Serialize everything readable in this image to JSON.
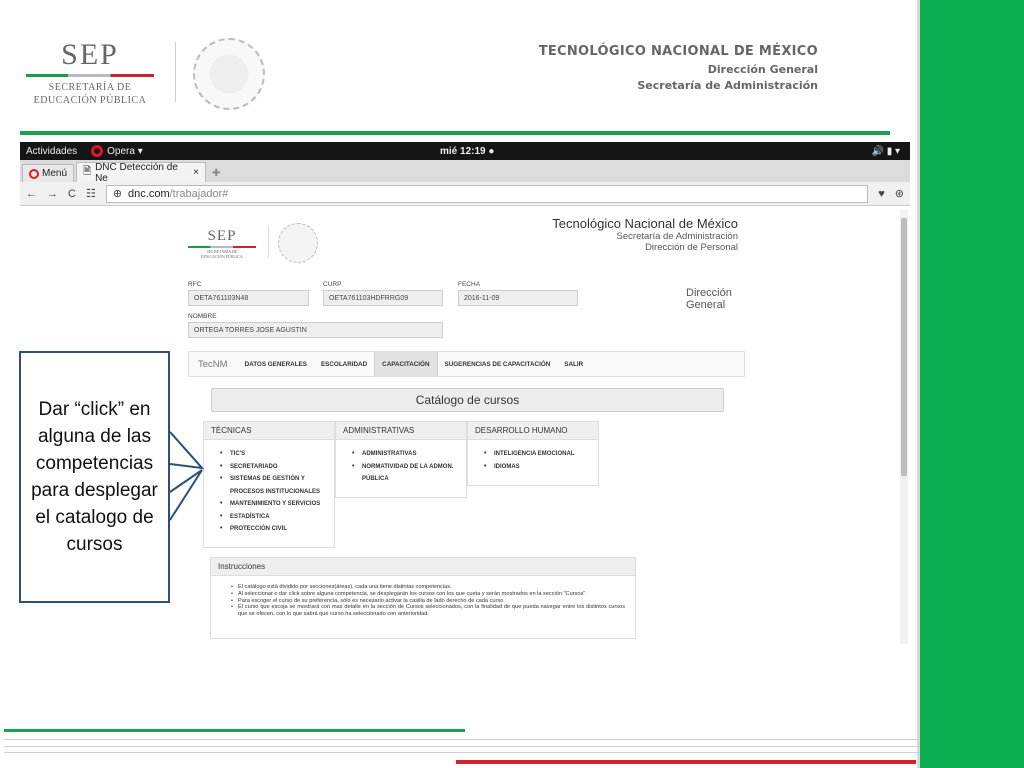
{
  "slide_header": {
    "sep_logo": {
      "sep": "SEP",
      "line1": "SECRETARÍA DE",
      "line2": "EDUCACIÓN PÚBLICA"
    },
    "title": "TECNOLÓGICO NACIONAL DE MÉXICO",
    "subtitle1": "Dirección General",
    "subtitle2": "Secretaría de Administración"
  },
  "os_bar": {
    "activities": "Actividades",
    "browser": "Opera ▾",
    "clock": "mié 12:19 ●",
    "tray": "🔊  ▮  ▾"
  },
  "browser": {
    "menu_label": "Menú",
    "tab_title": "DNC Detección de Ne",
    "tab_close": "×",
    "new_tab": "✚",
    "url_host": "dnc.com",
    "url_path": "/trabajador#",
    "nav_back": "←",
    "nav_forward": "→",
    "nav_reload": "C",
    "nav_grid": "☷"
  },
  "page": {
    "sep_logo": {
      "sep": "SEP",
      "sub1": "SECRETARÍA DE",
      "sub2": "EDUCACIÓN PÚBLICA"
    },
    "header_title": "Tecnológico Nacional de México",
    "header_sub1": "Secretaría de Administración",
    "header_sub2": "Dirección de Personal",
    "fields": {
      "rfc_label": "RFC",
      "rfc_value": "OETA761103N48",
      "curp_label": "CURP",
      "curp_value": "OETA761103HDFRRG09",
      "fecha_label": "FECHA",
      "fecha_value": "2016-11-09",
      "nombre_label": "NOMBRE",
      "nombre_value": "ORTEGA TORRES JOSE AGUSTIN"
    },
    "direccion_line1": "Dirección",
    "direccion_line2": "General",
    "nav": {
      "brand": "TecNM",
      "items": [
        "DATOS GENERALES",
        "ESCOLARIDAD",
        "CAPACITACIÓN",
        "SUGERENCIAS DE CAPACITACIÓN",
        "SALIR"
      ]
    },
    "catalog_title": "Catálogo de cursos",
    "panels": [
      {
        "title": "TÉCNICAS",
        "items": [
          "TIC'S",
          "SECRETARIADO",
          "SISTEMAS DE GESTIÓN Y",
          "PROCESOS INSTITUCIONALES",
          "MANTENIMIENTO Y SERVICIOS",
          "ESTADÍSTICA",
          "PROTECCIÓN CIVIL"
        ]
      },
      {
        "title": "ADMINISTRATIVAS",
        "items": [
          "ADMINISTRATIVAS",
          "NORMATIVIDAD DE LA ADMON.",
          "PÚBLICA"
        ]
      },
      {
        "title": "DESARROLLO HUMANO",
        "items": [
          "INTELIGENCIA EMOCIONAL",
          "IDIOMAS"
        ]
      }
    ],
    "instructions": {
      "title": "Instrucciones",
      "items": [
        "El catálogo está dividido por secciones(áreas), cada una tiene distintas competencias.",
        "Al seleccionar o dar click sobre alguna competencia, se desplegarán los cursos con los que cueta y serán mostrados en la sección \"Cursos\"",
        "Para escoger el curso de su preferencia, sólo es necesario activar la casilla de lado derecho de cada curso.",
        "El curso que escoja se mostrará con mas detalle en la sección de Cursos seleccionados, con la finalidad de que pueda navegar entre los distintos cursos que se ofecen, con lo que sabrá que curso ha seleccionado con anterioridad."
      ]
    }
  },
  "callout_text": "Dar “click” en alguna de las competencias para desplegar el catalogo de cursos",
  "colors": {
    "green": "#0aad50",
    "red": "#d42027",
    "callout_border": "#2f4f78"
  }
}
